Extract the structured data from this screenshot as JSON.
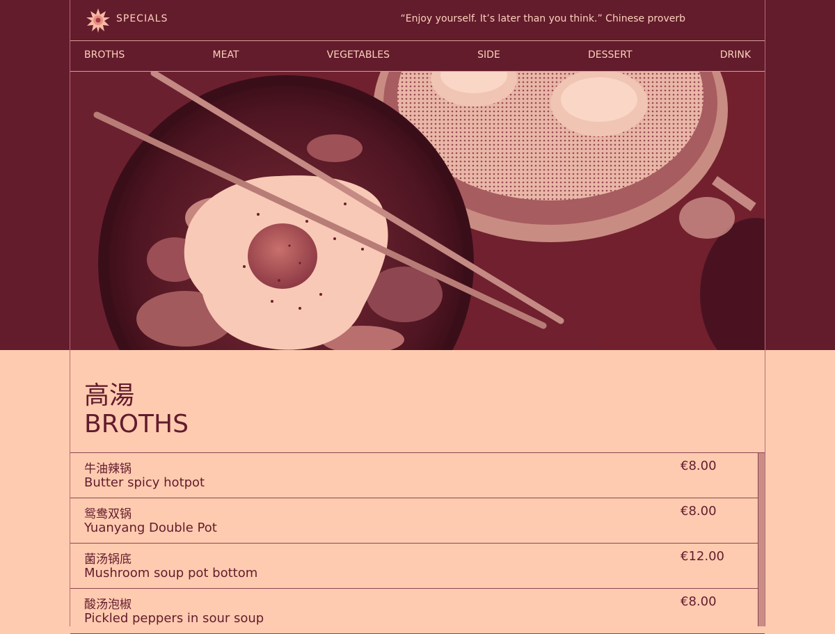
{
  "header": {
    "brand": "SPECIALS",
    "quote": "“Enjoy yourself. It’s later than you think.” Chinese proverb"
  },
  "nav": {
    "items": [
      "BROTHS",
      "MEAT",
      "VEGETABLES",
      "SIDE",
      "DESSERT",
      "DRINK"
    ]
  },
  "hero": {
    "image": "bowl of noodles with fried egg, chopsticks and steamed dumplings"
  },
  "section": {
    "title_cn": "高湯",
    "title_en": "BROTHS"
  },
  "menu_items": [
    {
      "cn": "牛油辣锅",
      "en": "Butter spicy hotpot",
      "price": "€8.00"
    },
    {
      "cn": "鸳鸯双锅",
      "en": "Yuanyang Double Pot",
      "price": "€8.00"
    },
    {
      "cn": "菌汤锅底",
      "en": "Mushroom soup pot bottom",
      "price": "€12.00"
    },
    {
      "cn": "酸汤泡椒",
      "en": "Pickled peppers in sour soup",
      "price": "€8.00"
    }
  ],
  "colors": {
    "primary": "#631c2c",
    "background": "#fecbb0",
    "text_light": "#fdd2bd"
  }
}
